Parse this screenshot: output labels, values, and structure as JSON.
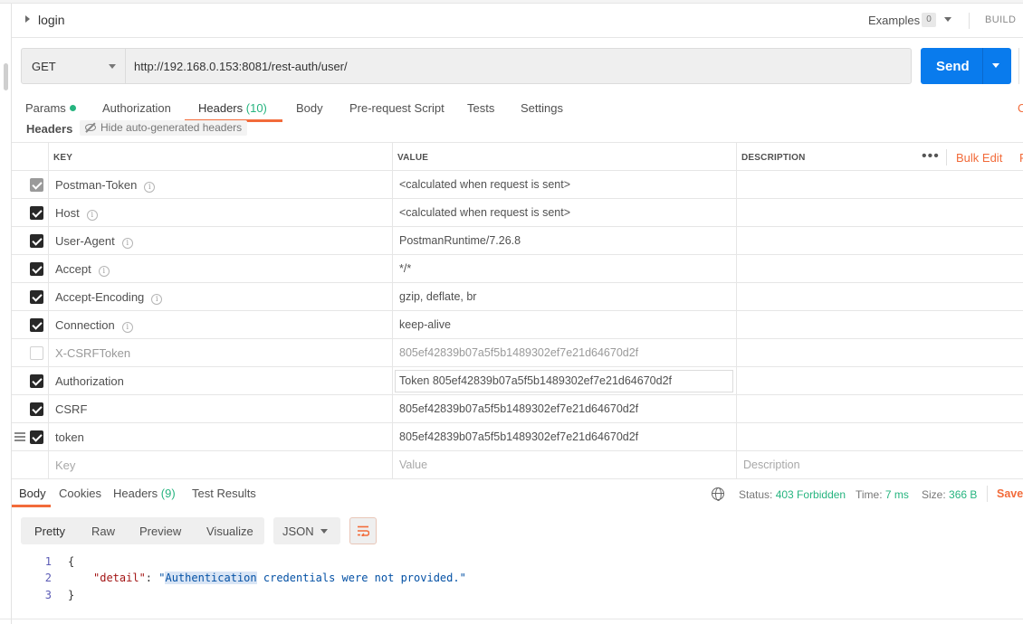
{
  "request": {
    "name": "login",
    "examples_label": "Examples",
    "examples_count": "0",
    "build_label": "BUILD",
    "method": "GET",
    "url": "http://192.168.0.153:8081/rest-auth/user/",
    "send_label": "Send",
    "cookies_label": "C"
  },
  "req_tabs": {
    "params": "Params",
    "authorization": "Authorization",
    "headers": "Headers",
    "headers_count": "(10)",
    "body": "Body",
    "prerequest": "Pre-request Script",
    "tests": "Tests",
    "settings": "Settings",
    "active": "Headers"
  },
  "headers_section": {
    "label": "Headers",
    "hide_auto": "Hide auto-generated headers"
  },
  "table": {
    "col_key": "KEY",
    "col_value": "VALUE",
    "col_description": "DESCRIPTION",
    "more": "•••",
    "bulk_edit": "Bulk Edit",
    "presets": "P",
    "rows": [
      {
        "key": "Postman-Token",
        "value": "<calculated when request is sent>"
      },
      {
        "key": "Host",
        "value": "<calculated when request is sent>"
      },
      {
        "key": "User-Agent",
        "value": "PostmanRuntime/7.26.8"
      },
      {
        "key": "Accept",
        "value": "*/*"
      },
      {
        "key": "Accept-Encoding",
        "value": "gzip, deflate, br"
      },
      {
        "key": "Connection",
        "value": "keep-alive"
      },
      {
        "key": "X-CSRFToken",
        "value": "805ef42839b07a5f5b1489302ef7e21d64670d2f"
      },
      {
        "key": "Authorization",
        "value": "Token 805ef42839b07a5f5b1489302ef7e21d64670d2f"
      },
      {
        "key": "CSRF",
        "value": "805ef42839b07a5f5b1489302ef7e21d64670d2f"
      },
      {
        "key": "token",
        "value": "805ef42839b07a5f5b1489302ef7e21d64670d2f"
      }
    ],
    "new_row": {
      "key_placeholder": "Key",
      "value_placeholder": "Value",
      "description_placeholder": "Description"
    }
  },
  "response": {
    "tabs": {
      "body": "Body",
      "cookies": "Cookies",
      "headers": "Headers",
      "headers_count": "(9)",
      "tests": "Test Results"
    },
    "status_label": "Status:",
    "status_value": "403 Forbidden",
    "time_label": "Time:",
    "time_value": "7 ms",
    "size_label": "Size:",
    "size_value": "366 B",
    "save_label": "Save",
    "views": {
      "pretty": "Pretty",
      "raw": "Raw",
      "preview": "Preview",
      "visualize": "Visualize"
    },
    "format": "JSON",
    "code": {
      "line1": "1",
      "line2": "2",
      "line3": "3",
      "open_brace": "{",
      "key": "\"detail\"",
      "colon": ": ",
      "value_quote_open": "\"",
      "value_highlight": "Authentication",
      "value_rest": " credentials were not provided.\"",
      "close_brace": "}"
    }
  },
  "colors": {
    "accent": "#f26b3a",
    "send": "#097bed",
    "ok_green": "#26b47f"
  }
}
